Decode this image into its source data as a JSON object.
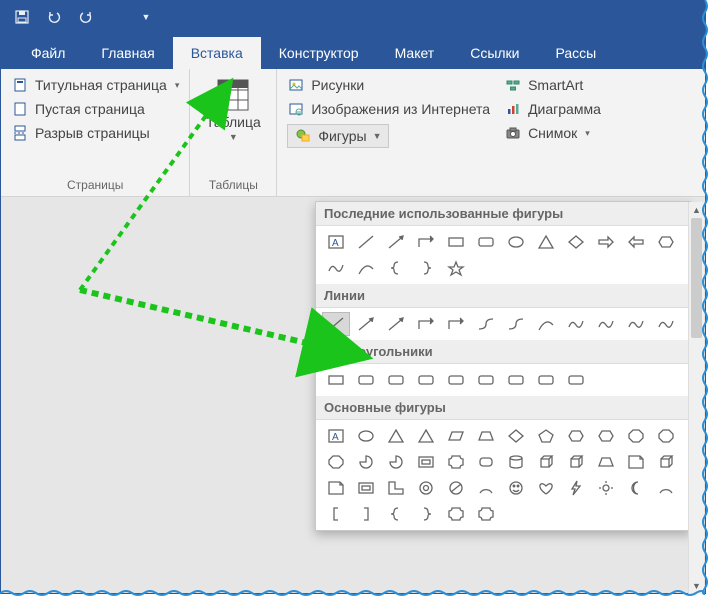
{
  "titlebar": {
    "icons": [
      "save-icon",
      "undo-icon",
      "redo-icon",
      "customize-icon"
    ]
  },
  "tabs": [
    {
      "id": "file",
      "label": "Файл",
      "active": false
    },
    {
      "id": "home",
      "label": "Главная",
      "active": false
    },
    {
      "id": "insert",
      "label": "Вставка",
      "active": true
    },
    {
      "id": "design",
      "label": "Конструктор",
      "active": false
    },
    {
      "id": "layout",
      "label": "Макет",
      "active": false
    },
    {
      "id": "references",
      "label": "Ссылки",
      "active": false
    },
    {
      "id": "mailings",
      "label": "Рассы",
      "active": false
    }
  ],
  "groups": {
    "pages": {
      "label": "Страницы",
      "items": [
        {
          "icon": "cover-page-icon",
          "label": "Титульная страница"
        },
        {
          "icon": "blank-page-icon",
          "label": "Пустая страница"
        },
        {
          "icon": "page-break-icon",
          "label": "Разрыв страницы"
        }
      ]
    },
    "tables": {
      "label": "Таблицы",
      "button": "Таблица"
    },
    "illustrations": {
      "leftcol": [
        {
          "icon": "pictures-icon",
          "label": "Рисунки"
        },
        {
          "icon": "online-pictures-icon",
          "label": "Изображения из Интернета"
        }
      ],
      "shapes_button": "Фигуры",
      "rightcol": [
        {
          "icon": "smartart-icon",
          "label": "SmartArt"
        },
        {
          "icon": "chart-icon",
          "label": "Диаграмма"
        },
        {
          "icon": "screenshot-icon",
          "label": "Снимок"
        }
      ]
    }
  },
  "dropdown": {
    "sections": [
      {
        "title": "Последние использованные фигуры",
        "rows": 2,
        "cols_row1": 12,
        "cols_row2": 6,
        "type": "recent"
      },
      {
        "title": "Линии",
        "rows": 1,
        "cols": 12,
        "type": "lines"
      },
      {
        "title": "Прямоугольники",
        "rows": 1,
        "cols": 9,
        "type": "rects"
      },
      {
        "title": "Основные фигуры",
        "rows": 4,
        "cols": 12,
        "type": "basic"
      }
    ]
  }
}
